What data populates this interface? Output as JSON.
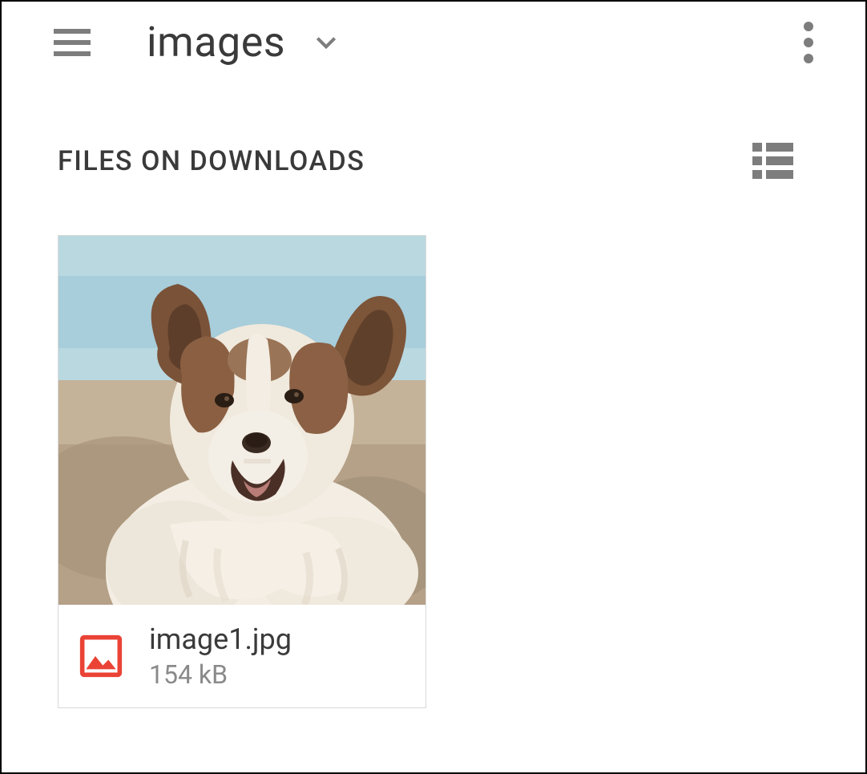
{
  "header": {
    "folder_name": "images"
  },
  "section": {
    "title": "FILES ON DOWNLOADS"
  },
  "files": [
    {
      "name": "image1.jpg",
      "size": "154 kB",
      "type": "image"
    }
  ]
}
